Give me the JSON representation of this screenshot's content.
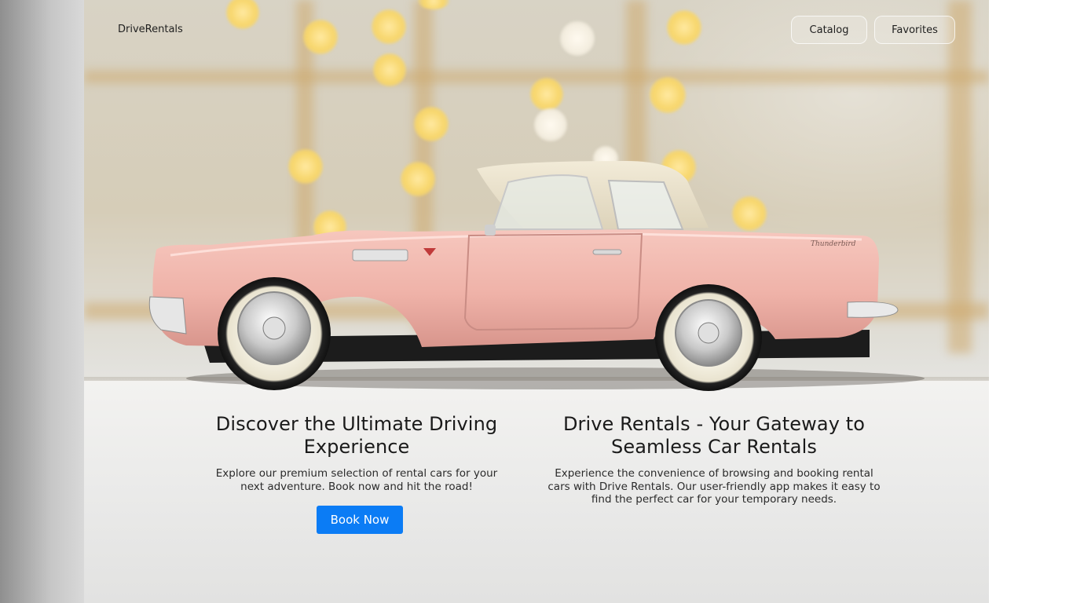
{
  "nav": {
    "brand": "DriveRentals",
    "catalog_label": "Catalog",
    "favorites_label": "Favorites"
  },
  "hero": {
    "image": "pink-thunderbird-toy-car",
    "car_badge_text": "Thunderbird"
  },
  "features": [
    {
      "title": "Discover the Ultimate Driving Experience",
      "description": "Explore our premium selection of rental cars for your next adventure. Book now and hit the road!",
      "cta_label": "Book Now"
    },
    {
      "title": "Drive Rentals - Your Gateway to Seamless Car Rentals",
      "description": "Experience the convenience of browsing and booking rental cars with Drive Rentals. Our user-friendly app makes it easy to find the perfect car for your temporary needs."
    }
  ],
  "colors": {
    "accent": "#0b7cf5",
    "text": "#1a1a1a",
    "car_body": "#f1b9b0"
  }
}
